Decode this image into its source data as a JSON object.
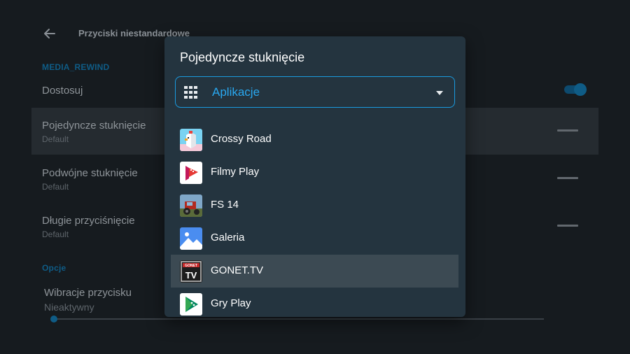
{
  "background": {
    "screen_title": "Przyciski niestandardowe",
    "section_button": "MEDIA_REWIND",
    "customize_label": "Dostosuj",
    "customize_enabled": true,
    "rows": [
      {
        "title": "Pojedyncze stuknięcie",
        "subtitle": "Default"
      },
      {
        "title": "Podwójne stuknięcie",
        "subtitle": "Default"
      },
      {
        "title": "Długie przyciśnięcie",
        "subtitle": "Default"
      }
    ],
    "section_options": "Opcje",
    "vibration": {
      "title": "Wibracje przycisku",
      "subtitle": "Nieaktywny"
    },
    "slider_value": 0
  },
  "dialog": {
    "title": "Pojedyncze stuknięcie",
    "dropdown": {
      "icon": "apps-grid-icon",
      "selected": "Aplikacje"
    },
    "apps": [
      {
        "name": "Crossy Road",
        "icon": "crossy-road-icon"
      },
      {
        "name": "Filmy Play",
        "icon": "play-movies-icon"
      },
      {
        "name": "FS 14",
        "icon": "fs14-icon"
      },
      {
        "name": "Galeria",
        "icon": "gallery-icon"
      },
      {
        "name": "GONET.TV",
        "icon": "gonet-tv-icon",
        "selected": true
      },
      {
        "name": "Gry Play",
        "icon": "play-games-icon"
      }
    ]
  },
  "colors": {
    "accent": "#29a8f0",
    "dialog_bg": "#24343f",
    "selected_row": "#3c4a53",
    "screen_bg": "#161b1f"
  }
}
